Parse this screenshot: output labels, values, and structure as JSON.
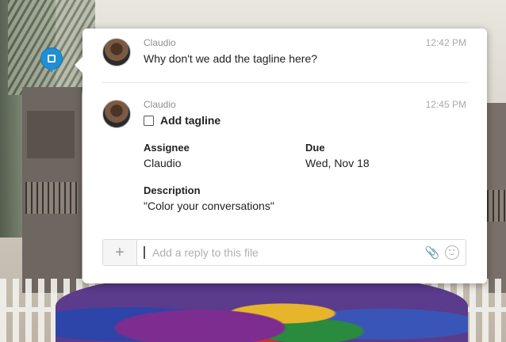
{
  "comments": [
    {
      "author": "Claudio",
      "time": "12:42 PM",
      "message": "Why don't we add the tagline here?"
    },
    {
      "author": "Claudio",
      "time": "12:45 PM",
      "task": {
        "title": "Add tagline",
        "checked": false,
        "assignee_label": "Assignee",
        "assignee": "Claudio",
        "due_label": "Due",
        "due": "Wed, Nov 18",
        "description_label": "Description",
        "description": "\"Color your conversations\""
      }
    }
  ],
  "reply": {
    "placeholder": "Add a reply to this file",
    "add_icon": "plus-icon",
    "attach_icon": "paperclip-icon",
    "emoji_icon": "smiley-icon"
  },
  "pin": {
    "icon": "comment-pin-icon",
    "color": "#1f8fd6"
  }
}
